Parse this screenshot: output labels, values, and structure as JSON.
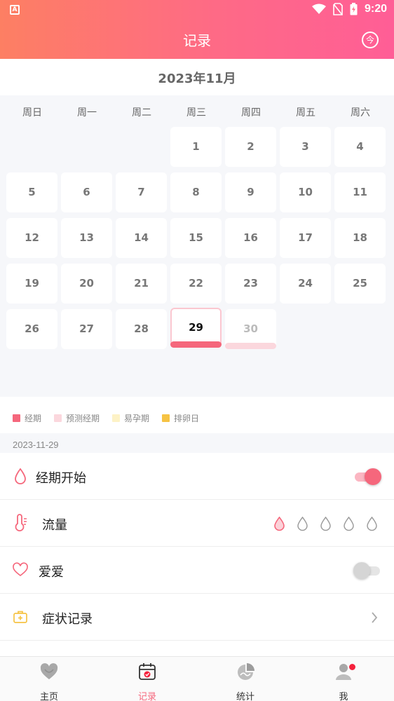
{
  "statusbar": {
    "time": "9:20",
    "app_badge": "A"
  },
  "header": {
    "title": "记录",
    "today_label": "今"
  },
  "calendar": {
    "month_title": "2023年11月",
    "weekdays": [
      "周日",
      "周一",
      "周二",
      "周三",
      "周四",
      "周五",
      "周六"
    ],
    "days": [
      "1",
      "2",
      "3",
      "4",
      "5",
      "6",
      "7",
      "8",
      "9",
      "10",
      "11",
      "12",
      "13",
      "14",
      "15",
      "16",
      "17",
      "18",
      "19",
      "20",
      "21",
      "22",
      "23",
      "24",
      "25",
      "26",
      "27",
      "28",
      "29",
      "30"
    ],
    "today": "29"
  },
  "legend": [
    {
      "label": "经期",
      "color": "#f5677c"
    },
    {
      "label": "预测经期",
      "color": "#fbd7dd"
    },
    {
      "label": "易孕期",
      "color": "#fdf2c6"
    },
    {
      "label": "排卵日",
      "color": "#f6c344"
    }
  ],
  "selected_date": "2023-11-29",
  "rows": {
    "period_start": {
      "label": "经期开始",
      "on": true
    },
    "flow": {
      "label": "流量",
      "selected_level": 1
    },
    "love": {
      "label": "爱爱",
      "on": false
    },
    "symptoms": {
      "label": "症状记录"
    }
  },
  "colors": {
    "accent": "#f5677c",
    "header_start": "#fd7f63",
    "header_end": "#ff5e96"
  },
  "nav": {
    "items": [
      {
        "label": "主页",
        "icon": "heart-icon"
      },
      {
        "label": "记录",
        "icon": "calendar-icon"
      },
      {
        "label": "统计",
        "icon": "pie-chart-icon"
      },
      {
        "label": "我",
        "icon": "user-icon"
      }
    ]
  }
}
